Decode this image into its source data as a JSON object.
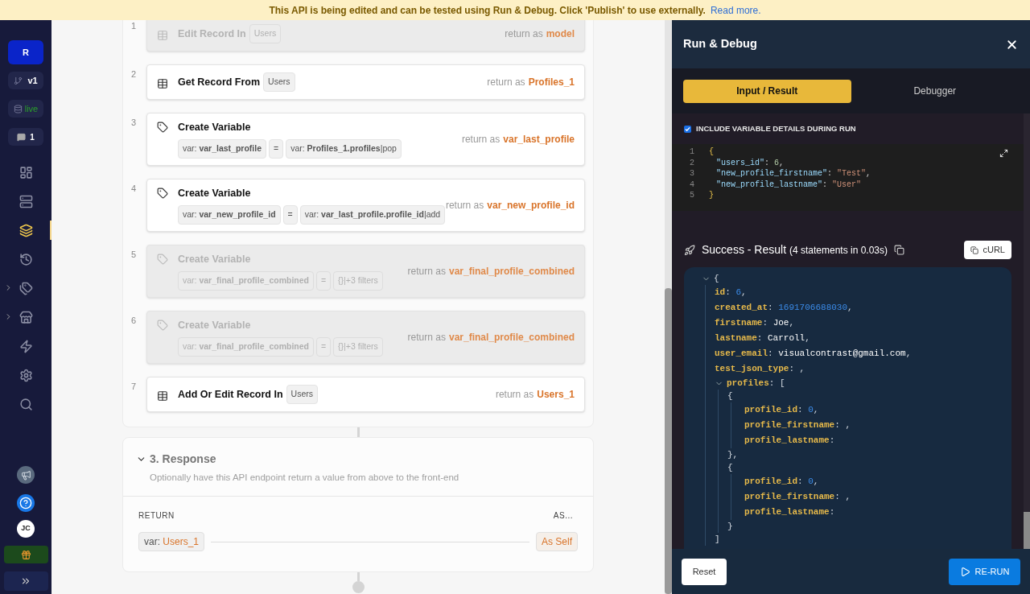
{
  "banner": {
    "text": "This API is being edited and can be tested using Run & Debug. Click 'Publish' to use externally.",
    "link": "Read more."
  },
  "sidebar": {
    "project": "R",
    "branch": "v1",
    "environment": "live",
    "comments": "1",
    "nav": [
      {
        "kind": "dashboard",
        "selected": false,
        "expandable": false
      },
      {
        "kind": "database",
        "selected": false,
        "expandable": false
      },
      {
        "kind": "api",
        "selected": true,
        "expandable": false
      },
      {
        "kind": "history",
        "selected": false,
        "expandable": false
      },
      {
        "kind": "addons",
        "selected": false,
        "expandable": true
      },
      {
        "kind": "marketplace",
        "selected": false,
        "expandable": true
      },
      {
        "kind": "triggers",
        "selected": false,
        "expandable": false
      },
      {
        "kind": "settings",
        "selected": false,
        "expandable": false
      },
      {
        "kind": "search",
        "selected": false,
        "expandable": false
      }
    ],
    "avatar": "JC"
  },
  "steps": [
    {
      "number": "1",
      "kind": "table",
      "title": "Edit Record In",
      "table": "Users",
      "disabled": true,
      "return_label": "return as",
      "return_name": "model"
    },
    {
      "number": "2",
      "kind": "table",
      "title": "Get Record From",
      "table": "Users",
      "disabled": false,
      "return_label": "return as",
      "return_name": "Profiles_1"
    },
    {
      "number": "3",
      "kind": "variable",
      "title": "Create Variable",
      "var": "var: **var_last_profile**",
      "op": "=",
      "value": "var: **Profiles_1.profiles**|pop",
      "disabled": false,
      "return_label": "return as",
      "return_name": "var_last_profile"
    },
    {
      "number": "4",
      "kind": "variable",
      "title": "Create Variable",
      "var": "var: **var_new_profile_id**",
      "op": "=",
      "value": "var: **var_last_profile.profile_id**|add",
      "disabled": false,
      "return_label": "return as",
      "return_name": "var_new_profile_id"
    },
    {
      "number": "5",
      "kind": "variable",
      "title": "Create Variable",
      "var": "var: **var_final_profile_combined**",
      "op": "=",
      "value": "{}|+3 filters",
      "disabled": true,
      "return_label": "return as",
      "return_name": "var_final_profile_combined"
    },
    {
      "number": "6",
      "kind": "variable",
      "title": "Create Variable",
      "var": "var: **var_final_profile_combined**",
      "op": "=",
      "value": "{}|+3 filters",
      "disabled": true,
      "return_label": "return as",
      "return_name": "var_final_profile_combined"
    },
    {
      "number": "7",
      "kind": "table",
      "title": "Add Or Edit Record In",
      "table": "Users",
      "disabled": false,
      "return_label": "return as",
      "return_name": "Users_1"
    }
  ],
  "response": {
    "title": "3. Response",
    "expanded": true,
    "description": "Optionally have this API endpoint return a value from above to the front-end",
    "return_header": "RETURN",
    "as_header": "AS...",
    "return_prefix": "var:",
    "return_var": "Users_1",
    "as_value": "As Self"
  },
  "debug": {
    "title": "Run & Debug",
    "tabs": [
      {
        "label": "Input / Result",
        "selected": true
      },
      {
        "label": "Debugger",
        "selected": false
      }
    ],
    "include_details": {
      "label": "INCLUDE VARIABLE DETAILS DURING RUN",
      "checked": true
    },
    "input_lines": [
      {
        "number": "1",
        "tokens": [
          {
            "kind": "brace",
            "text": "{"
          }
        ]
      },
      {
        "number": "2",
        "tokens": [
          {
            "kind": "key",
            "text": "\"users_id\""
          },
          {
            "kind": "punct",
            "text": ": "
          },
          {
            "kind": "number",
            "text": "6"
          },
          {
            "kind": "punct",
            "text": ","
          }
        ]
      },
      {
        "number": "3",
        "tokens": [
          {
            "kind": "key",
            "text": "\"new_profile_firstname\""
          },
          {
            "kind": "punct",
            "text": ": "
          },
          {
            "kind": "string",
            "text": "\"Test\""
          },
          {
            "kind": "punct",
            "text": ","
          }
        ]
      },
      {
        "number": "4",
        "tokens": [
          {
            "kind": "key",
            "text": "\"new_profile_lastname\""
          },
          {
            "kind": "punct",
            "text": ": "
          },
          {
            "kind": "string",
            "text": "\"User\""
          }
        ]
      },
      {
        "number": "5",
        "tokens": [
          {
            "kind": "brace",
            "text": "}"
          }
        ]
      }
    ],
    "result_status": "Success - Result",
    "result_detail": "(4 statements in 0.03s)",
    "curl": "cURL",
    "result": {
      "kind": "group",
      "expanded": true,
      "open": [
        {
          "kind": "punct",
          "text": "{"
        }
      ],
      "children": [
        {
          "kind": "field",
          "tokens": [
            {
              "kind": "key",
              "text": "id"
            },
            {
              "kind": "punct",
              "text": ": "
            },
            {
              "kind": "number",
              "text": "6"
            },
            {
              "kind": "punct",
              "text": ","
            }
          ]
        },
        {
          "kind": "field",
          "tokens": [
            {
              "kind": "key",
              "text": "created_at"
            },
            {
              "kind": "punct",
              "text": ": "
            },
            {
              "kind": "number",
              "text": "1691706688030"
            },
            {
              "kind": "punct",
              "text": ","
            }
          ]
        },
        {
          "kind": "field",
          "tokens": [
            {
              "kind": "key",
              "text": "firstname"
            },
            {
              "kind": "punct",
              "text": ": "
            },
            {
              "kind": "text",
              "text": "Joe"
            },
            {
              "kind": "punct",
              "text": ","
            }
          ]
        },
        {
          "kind": "field",
          "tokens": [
            {
              "kind": "key",
              "text": "lastname"
            },
            {
              "kind": "punct",
              "text": ": "
            },
            {
              "kind": "text",
              "text": "Carroll"
            },
            {
              "kind": "punct",
              "text": ","
            }
          ]
        },
        {
          "kind": "field",
          "tokens": [
            {
              "kind": "key",
              "text": "user_email"
            },
            {
              "kind": "punct",
              "text": ": "
            },
            {
              "kind": "text",
              "text": "visualcontrast@gmail.com"
            },
            {
              "kind": "punct",
              "text": ","
            }
          ]
        },
        {
          "kind": "field",
          "tokens": [
            {
              "kind": "key",
              "text": "test_json_type"
            },
            {
              "kind": "punct",
              "text": ": ,"
            }
          ]
        },
        {
          "kind": "group",
          "expanded": true,
          "open": [
            {
              "kind": "key",
              "text": "profiles"
            },
            {
              "kind": "punct",
              "text": ": ["
            }
          ],
          "children": [
            {
              "kind": "group",
              "open": [
                {
                  "kind": "punct",
                  "text": "{"
                }
              ],
              "children": [
                {
                  "kind": "field",
                  "tokens": [
                    {
                      "kind": "key",
                      "text": "profile_id"
                    },
                    {
                      "kind": "punct",
                      "text": ": "
                    },
                    {
                      "kind": "number",
                      "text": "0"
                    },
                    {
                      "kind": "punct",
                      "text": ","
                    }
                  ]
                },
                {
                  "kind": "field",
                  "tokens": [
                    {
                      "kind": "key",
                      "text": "profile_firstname"
                    },
                    {
                      "kind": "punct",
                      "text": ": ,"
                    }
                  ]
                },
                {
                  "kind": "field",
                  "tokens": [
                    {
                      "kind": "key",
                      "text": "profile_lastname"
                    },
                    {
                      "kind": "punct",
                      "text": ":"
                    }
                  ]
                }
              ],
              "close": [
                {
                  "kind": "punct",
                  "text": "},"
                }
              ]
            },
            {
              "kind": "group",
              "open": [
                {
                  "kind": "punct",
                  "text": "{"
                }
              ],
              "children": [
                {
                  "kind": "field",
                  "tokens": [
                    {
                      "kind": "key",
                      "text": "profile_id"
                    },
                    {
                      "kind": "punct",
                      "text": ": "
                    },
                    {
                      "kind": "number",
                      "text": "0"
                    },
                    {
                      "kind": "punct",
                      "text": ","
                    }
                  ]
                },
                {
                  "kind": "field",
                  "tokens": [
                    {
                      "kind": "key",
                      "text": "profile_firstname"
                    },
                    {
                      "kind": "punct",
                      "text": ": ,"
                    }
                  ]
                },
                {
                  "kind": "field",
                  "tokens": [
                    {
                      "kind": "key",
                      "text": "profile_lastname"
                    },
                    {
                      "kind": "punct",
                      "text": ":"
                    }
                  ]
                }
              ],
              "close": [
                {
                  "kind": "punct",
                  "text": "}"
                }
              ]
            }
          ],
          "close": [
            {
              "kind": "punct",
              "text": "]"
            }
          ]
        }
      ]
    },
    "reset": "Reset",
    "rerun": "RE-RUN"
  }
}
